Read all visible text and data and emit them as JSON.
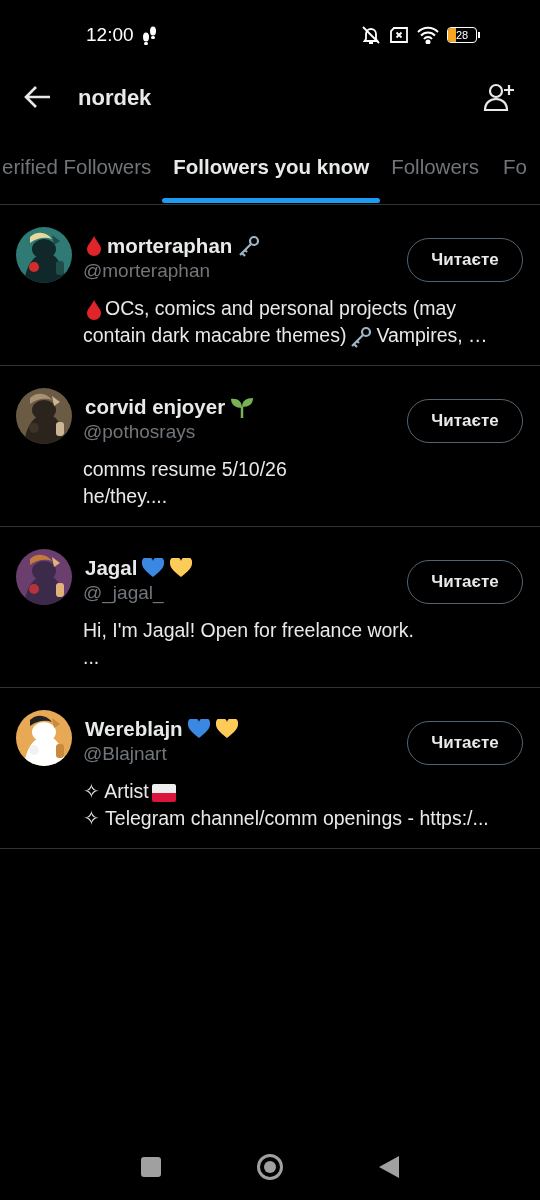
{
  "status_bar": {
    "time": "12:00",
    "battery": "28"
  },
  "header": {
    "title": "nordek"
  },
  "tabs": [
    {
      "label": "erified Followers",
      "selected": false
    },
    {
      "label": "Followers you know",
      "selected": true
    },
    {
      "label": "Followers",
      "selected": false
    },
    {
      "label": "Fo",
      "selected": false
    }
  ],
  "users": [
    {
      "avatar": {
        "kind": "picture"
      },
      "name_parts": [
        {
          "kind": "drop"
        },
        {
          "kind": "text",
          "text": "morteraphan"
        },
        {
          "kind": "key"
        }
      ],
      "handle": "@morteraphan",
      "button": "Читаєте",
      "bio": [
        [
          {
            "kind": "drop"
          },
          {
            "kind": "text",
            "text": "OCs, comics and personal projects (may"
          }
        ],
        [
          {
            "kind": "text",
            "text": "contain dark macabre themes)"
          },
          {
            "kind": "key"
          },
          {
            "kind": "text",
            "text": "Vampires, …"
          }
        ]
      ]
    },
    {
      "avatar": {
        "kind": "picture"
      },
      "name_parts": [
        {
          "kind": "text",
          "text": "corvid enjoyer"
        },
        {
          "kind": "sprout"
        }
      ],
      "handle": "@pothosrays",
      "button": "Читаєте",
      "bio": [
        [
          {
            "kind": "text",
            "text": "comms resume 5/10/26"
          }
        ],
        [
          {
            "kind": "text",
            "text": "he/they...."
          }
        ]
      ]
    },
    {
      "avatar": {
        "kind": "picture"
      },
      "name_parts": [
        {
          "kind": "text",
          "text": "Jagal"
        },
        {
          "kind": "blueheart"
        },
        {
          "kind": "yellowheart"
        }
      ],
      "handle": "@_jagal_",
      "button": "Читаєте",
      "bio": [
        [
          {
            "kind": "text",
            "text": "Hi, I'm Jagal! Open for freelance work."
          }
        ],
        [
          {
            "kind": "text",
            "text": "..."
          }
        ]
      ]
    },
    {
      "avatar": {
        "kind": "picture"
      },
      "name_parts": [
        {
          "kind": "text",
          "text": "Wereblajn"
        },
        {
          "kind": "blueheart"
        },
        {
          "kind": "yellowheart"
        }
      ],
      "handle": "@Blajnart",
      "button": "Читаєте",
      "bio": [
        [
          {
            "kind": "text",
            "text": "✧ Artist"
          },
          {
            "kind": "flag"
          }
        ],
        [
          {
            "kind": "text",
            "text": "✧ Telegram channel/comm openings - https:/..."
          }
        ]
      ]
    }
  ]
}
